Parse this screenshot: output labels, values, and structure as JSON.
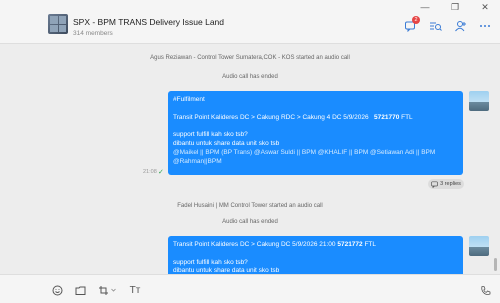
{
  "window": {
    "minimize_glyph": "—",
    "restore_glyph": "❐",
    "close_glyph": "✕"
  },
  "header": {
    "title": "SPX - BPM TRANS Delivery Issue Land",
    "members": "314 members",
    "notification_count": "2",
    "icons": [
      "chat-notice-icon",
      "search-list-icon",
      "add-member-icon",
      "more-icon"
    ]
  },
  "messages": {
    "sys1": "Agus Reziawan - Control Tower Sumatera,COK - KOS started an audio call",
    "sys2": "Audio call has ended",
    "msg1": {
      "tag": "#Fulfilment",
      "route": "Transit Point Kalideres DC > Cakung RDC > Cakung 4 DC  5/9/2026",
      "route_bold": "5721770",
      "route_suffix": " FTL",
      "question": "support fulfill kah sko tsb?",
      "request": "dibantu untuk share data unit sko tsb",
      "mentions1": "@Maikel || BPM (BP Trans) @Aswar Suldi || BPM @KHALIF || BPM @Setiawan Adi || BPM",
      "mentions2": "@Rahman||BPM",
      "time": "21:08",
      "status": "✓",
      "replies": "3 replies"
    },
    "sys3": "Fadel Husaini | MM Control Tower started an audio call",
    "sys4": "Audio call has ended",
    "msg2": {
      "route": "Transit Point Kalideres DC > Cakung DC 5/9/2026    21:00",
      "route_bold": "5721772",
      "route_suffix": "  FTL",
      "question": "support fulfill kah sko tsb?",
      "request": "dibantu untuk share data unit sko tsb"
    }
  },
  "toolbar": {
    "text_format_label": "Tт",
    "icons": [
      "emoji-icon",
      "folder-icon",
      "crop-icon",
      "text-format-icon",
      "phone-icon"
    ]
  }
}
